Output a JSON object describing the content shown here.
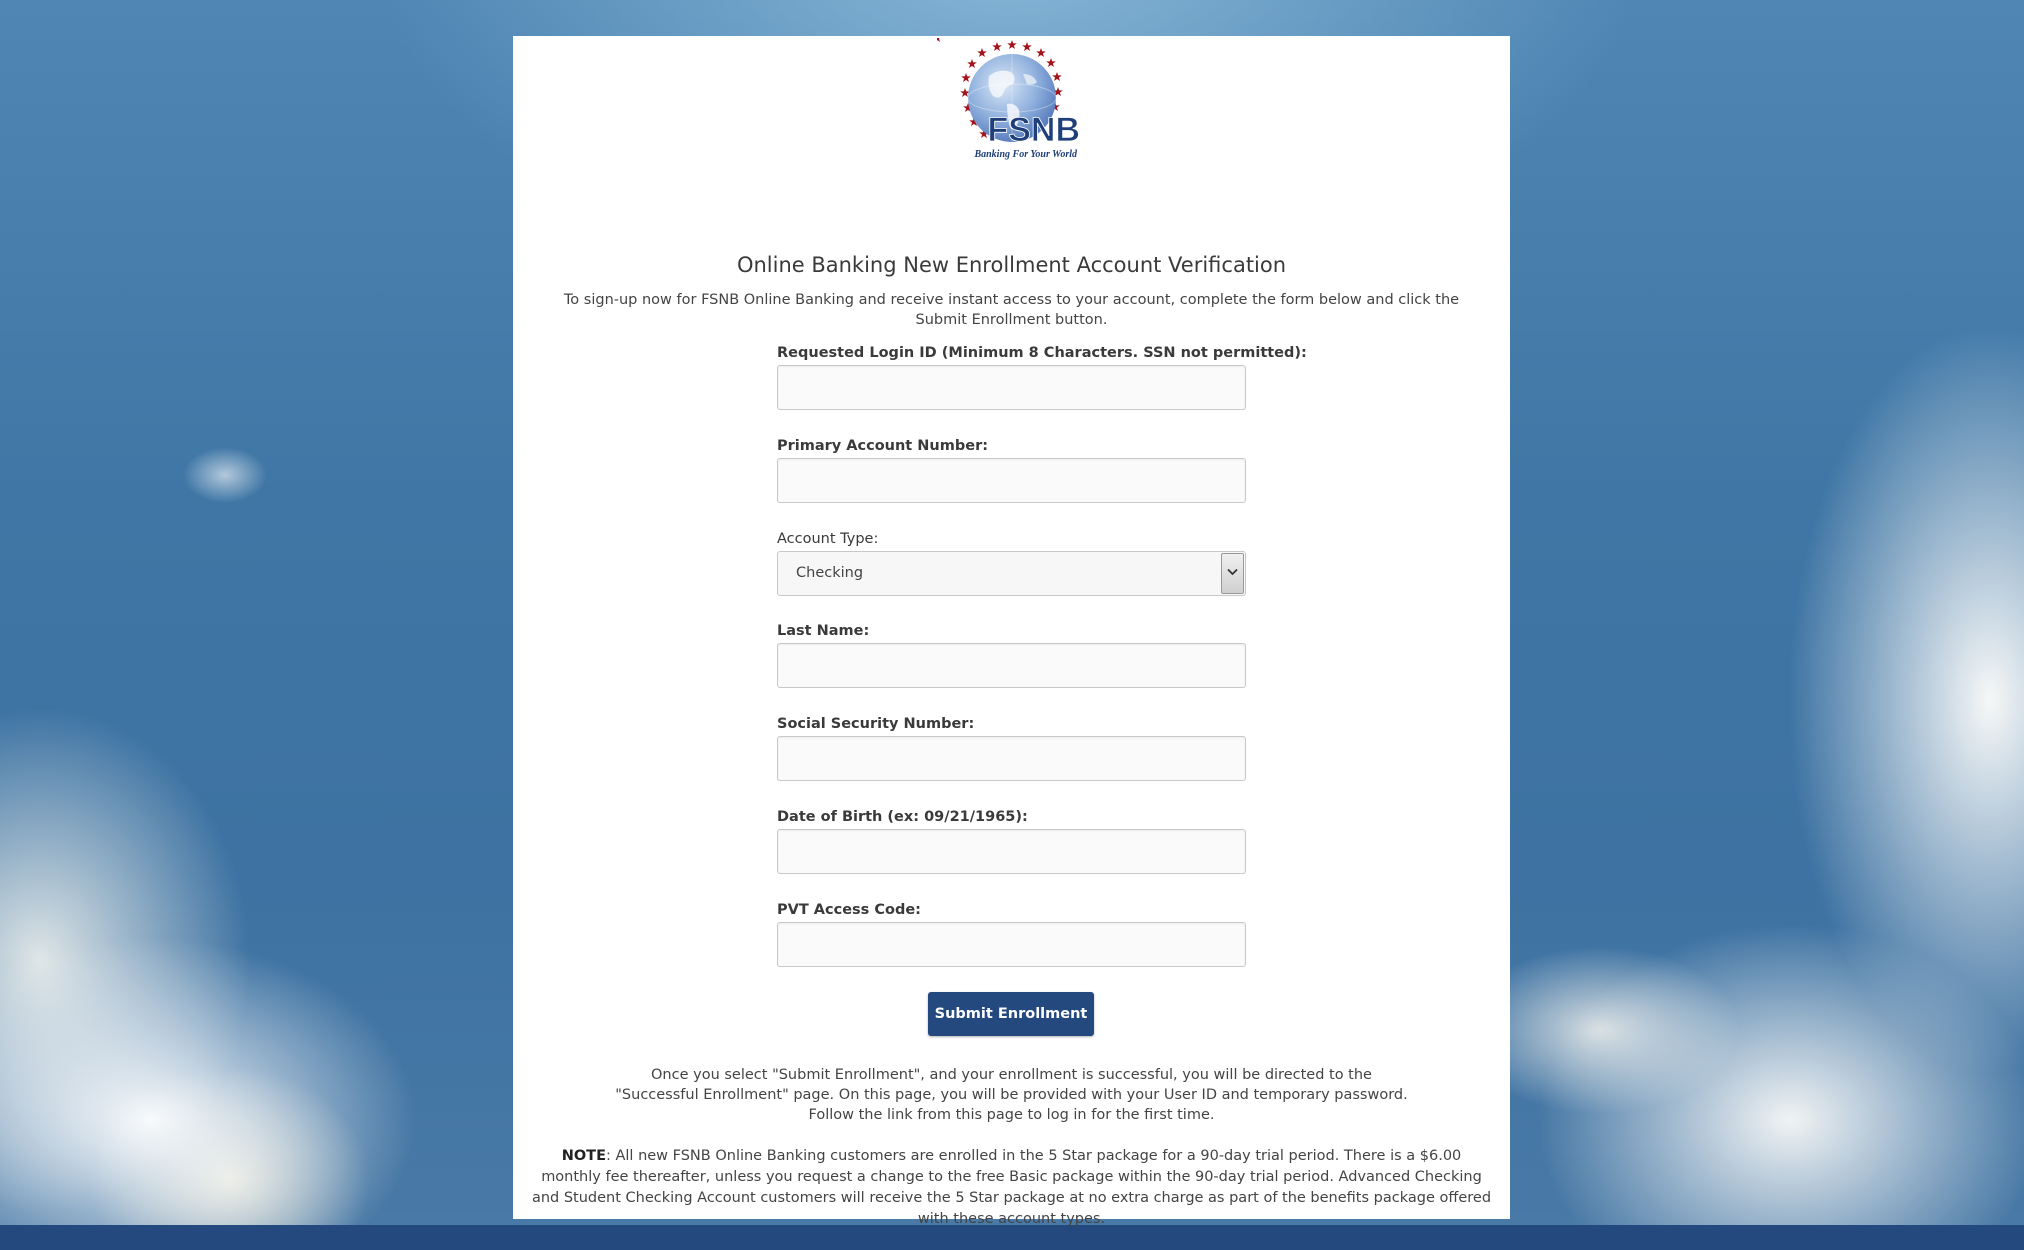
{
  "logo": {
    "name": "FSNB",
    "tagline": "Banking For Your World"
  },
  "page": {
    "title": "Online Banking New Enrollment Account Verification",
    "intro": "To sign-up now for FSNB Online Banking and receive instant access to your account, complete the form below and click the Submit Enrollment button."
  },
  "form": {
    "login_id": {
      "label": "Requested Login ID (Minimum 8 Characters. SSN not permitted):",
      "value": ""
    },
    "account_number": {
      "label": "Primary Account Number:",
      "value": ""
    },
    "account_type": {
      "label": "Account Type:",
      "selected": "Checking"
    },
    "last_name": {
      "label": "Last Name:",
      "value": ""
    },
    "ssn": {
      "label": "Social Security Number:",
      "value": ""
    },
    "dob": {
      "label": "Date of Birth (ex: 09/21/1965):",
      "value": ""
    },
    "pvt_code": {
      "label": "PVT Access Code:",
      "value": ""
    },
    "submit_label": "Submit Enrollment"
  },
  "after_submit": {
    "line1": "Once you select \"Submit Enrollment\", and your enrollment is successful, you will be directed to the",
    "line2": "\"Successful Enrollment\" page. On this page, you will be provided with your User ID and temporary password.",
    "line3": "Follow the link from this page to log in for the first time."
  },
  "note": {
    "label": "NOTE",
    "text": ": All new FSNB Online Banking customers are enrolled in the 5 Star package for a 90-day trial period. There is a $6.00 monthly fee thereafter, unless you request a change to the free Basic package within the 90-day trial period. Advanced Checking and Student Checking Account customers will receive the 5 Star package at no extra charge as part of the benefits package offered with these account types."
  },
  "colors": {
    "brand_navy": "#23497f",
    "logo_star_red": "#a3141c",
    "globe_blue": "#7ea3d8"
  }
}
